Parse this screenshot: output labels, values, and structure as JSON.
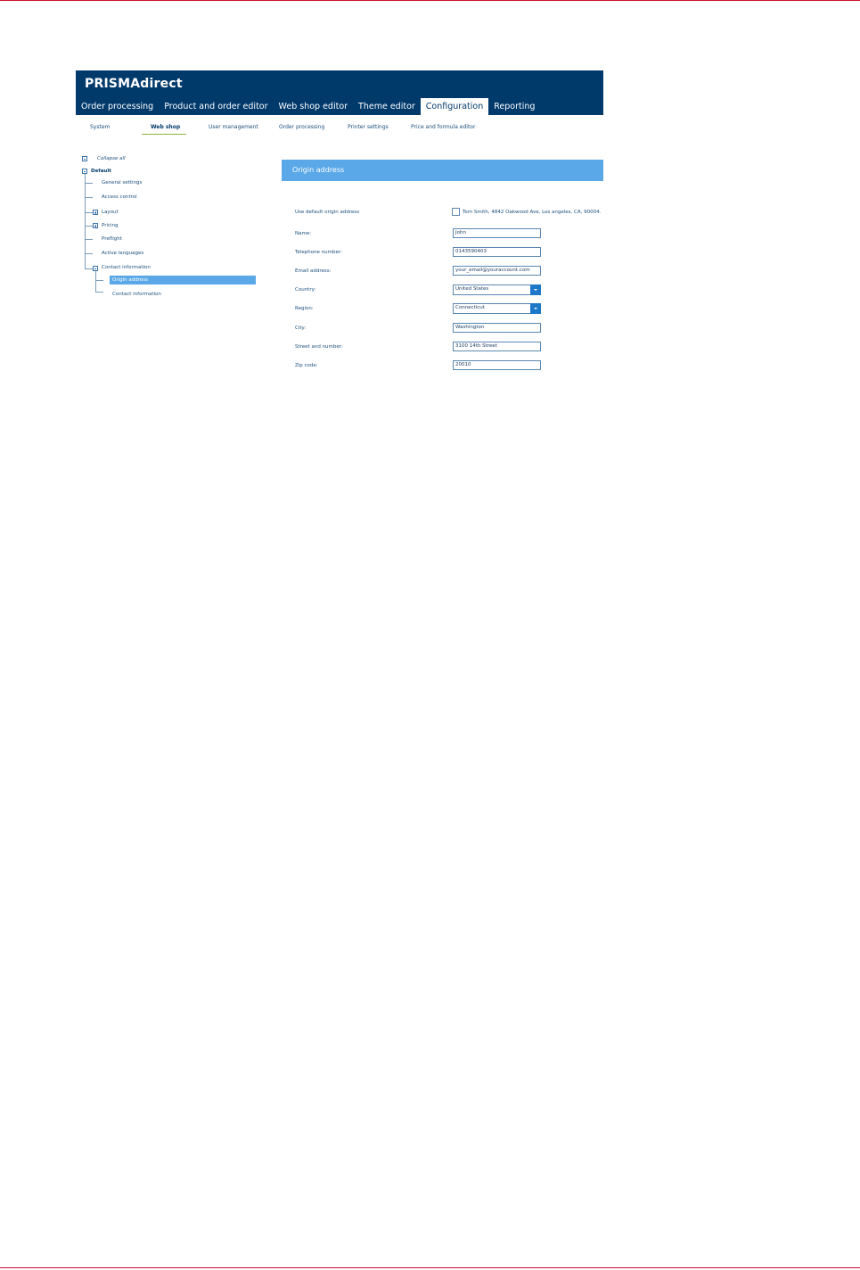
{
  "app": {
    "brand": "PRISMAdirect"
  },
  "main_nav": [
    {
      "label": "Order processing"
    },
    {
      "label": "Product and order editor"
    },
    {
      "label": "Web shop editor"
    },
    {
      "label": "Theme editor"
    },
    {
      "label": "Configuration",
      "active": true
    },
    {
      "label": "Reporting"
    }
  ],
  "sub_nav": [
    {
      "label": "System"
    },
    {
      "label": "Web shop",
      "active": true
    },
    {
      "label": "User management"
    },
    {
      "label": "Order processing"
    },
    {
      "label": "Printer settings"
    },
    {
      "label": "Price and formula editor"
    }
  ],
  "tree": {
    "collapse_all": "Collapse all",
    "root": "Default",
    "items": [
      {
        "label": "General settings"
      },
      {
        "label": "Access control"
      },
      {
        "label": "Layout"
      },
      {
        "label": "Pricing"
      },
      {
        "label": "Preflight"
      },
      {
        "label": "Active languages"
      },
      {
        "label": "Contact information"
      }
    ],
    "children": [
      {
        "label": "Origin address",
        "selected": true
      },
      {
        "label": "Contact information"
      }
    ]
  },
  "panel": {
    "title": "Origin address",
    "default_label": "Use default origin address",
    "default_text": "Tom Smith, 4842 Oakwood Ave, Los angeles, CA, 90004.",
    "fields": [
      {
        "label": "Name:",
        "value": "John"
      },
      {
        "label": "Telephone number:",
        "value": "0143590403"
      },
      {
        "label": "Email address:",
        "value": "your_email@youraccount.com"
      },
      {
        "label": "Country:",
        "value": "United States"
      },
      {
        "label": "Region:",
        "value": "Connecticut"
      },
      {
        "label": "City:",
        "value": "Washington"
      },
      {
        "label": "Street and number:",
        "value": "3100 14th Street"
      },
      {
        "label": "Zip code:",
        "value": "20010"
      }
    ]
  },
  "colors": {
    "header": "#003a6b",
    "accent": "#5aa8e8",
    "dropdown": "#1e78c8",
    "underline": "#8fb33b"
  }
}
